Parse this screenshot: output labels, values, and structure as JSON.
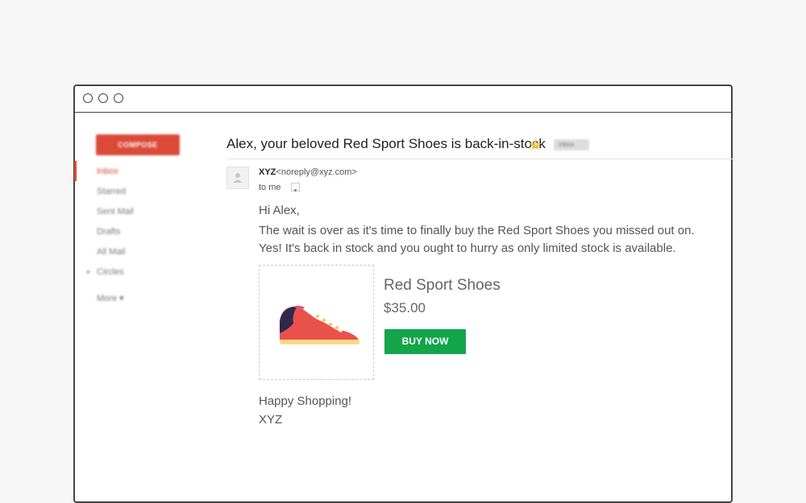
{
  "sidebar": {
    "compose_label": "COMPOSE",
    "items": [
      {
        "label": "Inbox",
        "active": true
      },
      {
        "label": "Starred"
      },
      {
        "label": "Sent Mail"
      },
      {
        "label": "Drafts"
      },
      {
        "label": "All Mail"
      },
      {
        "label": "Circles"
      }
    ],
    "more_label": "More ▾"
  },
  "email": {
    "subject": "Alex, your beloved Red Sport Shoes is back-in-stock",
    "label_chip": "Inbox",
    "sender_name": "XYZ",
    "sender_email": "<noreply@xyz.com>",
    "to_label": "to me",
    "greeting": "Hi Alex,",
    "line1": "The wait is over as it's time to finally buy the Red Sport Shoes you missed out on.",
    "line2": "Yes! It's back in stock and you ought to hurry as only limited stock is available.",
    "product": {
      "name": "Red Sport Shoes",
      "price": "$35.00",
      "button_label": "BUY NOW",
      "image": "red-sneaker-image"
    },
    "signoff": "Happy Shopping!",
    "signature": "XYZ"
  },
  "colors": {
    "accent": "#db4a39",
    "buy_button": "#12a54a",
    "star": "#f7c948"
  }
}
